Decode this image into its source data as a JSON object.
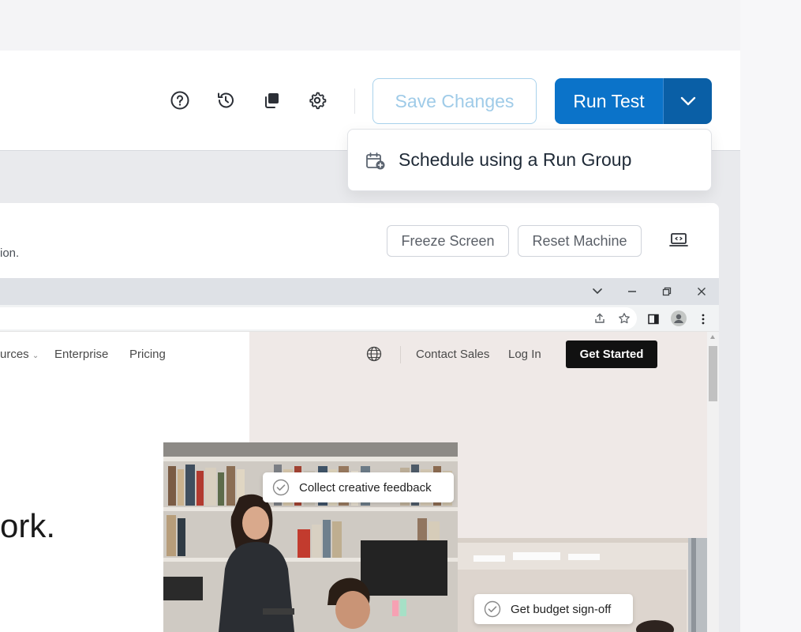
{
  "toolbar": {
    "save_label": "Save Changes",
    "run_label": "Run Test",
    "icons": [
      "help-icon",
      "history-icon",
      "duplicate-icon",
      "settings-icon",
      "chevron-down-icon"
    ]
  },
  "dropdown": {
    "items": [
      {
        "label": "Schedule using a Run Group",
        "icon": "calendar-add-icon"
      }
    ]
  },
  "panel": {
    "description_fragment": "ion.",
    "freeze_label": "Freeze Screen",
    "reset_label": "Reset Machine"
  },
  "website": {
    "nav_left": [
      "urces",
      "Enterprise",
      "Pricing"
    ],
    "nav_right": [
      "Contact Sales",
      "Log In"
    ],
    "cta_label": "Get Started",
    "hero_fragment": "ork.",
    "badges": [
      "Collect creative feedback",
      "Get budget sign-off"
    ]
  },
  "colors": {
    "primary": "#0b73c9",
    "primary_dark": "#0a5fa6",
    "save_border": "#a9d2ec",
    "cta_bg": "#111111"
  }
}
